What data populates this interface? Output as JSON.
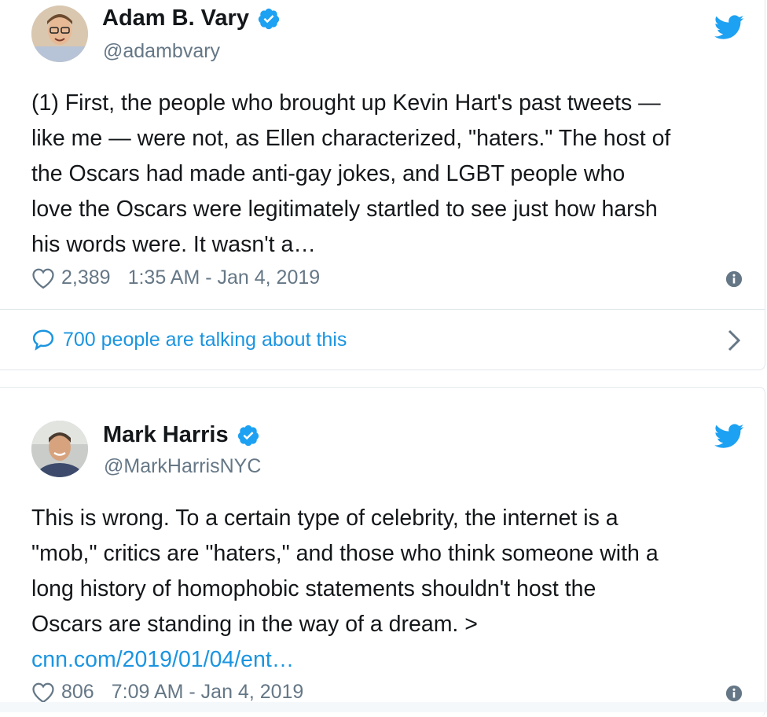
{
  "tweets": [
    {
      "author_name": "Adam B. Vary",
      "handle": "@adambvary",
      "body_lines": [
        "(1) First, the people who brought up Kevin Hart's past tweets —",
        "like me — were not, as Ellen characterized, \"haters.\" The host of",
        "the Oscars had made anti-gay jokes, and LGBT people who",
        "love the Oscars were legitimately startled to see just how harsh",
        "his words were. It wasn't a…"
      ],
      "likes": "2,389",
      "timestamp": "1:35 AM - Jan 4, 2019",
      "conversation": "700 people are talking about this"
    },
    {
      "author_name": "Mark Harris",
      "handle": "@MarkHarrisNYC",
      "body_lines": [
        "This is wrong. To a certain type of celebrity, the internet is a",
        "\"mob,\" critics are \"haters,\" and those who think someone with a",
        "long history of homophobic statements shouldn't host the",
        "Oscars are standing in the way of a dream. >"
      ],
      "link": "cnn.com/2019/01/04/ent…",
      "likes": "806",
      "timestamp": "7:09 AM - Jan 4, 2019"
    }
  ],
  "colors": {
    "twitter_blue": "#1da1f2",
    "link_blue": "#1b95e0",
    "secondary_text": "#657786",
    "border": "#e1e8ed"
  },
  "icons": [
    "verified-icon",
    "twitter-bird-icon",
    "heart-icon",
    "info-icon",
    "speech-bubble-icon",
    "chevron-right-icon"
  ]
}
